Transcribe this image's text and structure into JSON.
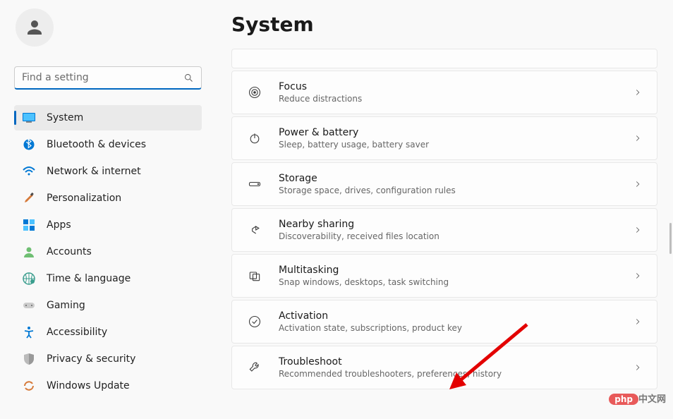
{
  "search": {
    "placeholder": "Find a setting"
  },
  "nav": [
    {
      "label": "System",
      "icon": "display",
      "selected": true
    },
    {
      "label": "Bluetooth & devices",
      "icon": "bluetooth"
    },
    {
      "label": "Network & internet",
      "icon": "wifi"
    },
    {
      "label": "Personalization",
      "icon": "brush"
    },
    {
      "label": "Apps",
      "icon": "apps"
    },
    {
      "label": "Accounts",
      "icon": "user"
    },
    {
      "label": "Time & language",
      "icon": "globe"
    },
    {
      "label": "Gaming",
      "icon": "gamepad"
    },
    {
      "label": "Accessibility",
      "icon": "accessibility"
    },
    {
      "label": "Privacy & security",
      "icon": "shield"
    },
    {
      "label": "Windows Update",
      "icon": "update"
    }
  ],
  "page": {
    "title": "System"
  },
  "cards": [
    {
      "title": "Focus",
      "sub": "Reduce distractions",
      "icon": "focus"
    },
    {
      "title": "Power & battery",
      "sub": "Sleep, battery usage, battery saver",
      "icon": "power"
    },
    {
      "title": "Storage",
      "sub": "Storage space, drives, configuration rules",
      "icon": "storage"
    },
    {
      "title": "Nearby sharing",
      "sub": "Discoverability, received files location",
      "icon": "share"
    },
    {
      "title": "Multitasking",
      "sub": "Snap windows, desktops, task switching",
      "icon": "multitask"
    },
    {
      "title": "Activation",
      "sub": "Activation state, subscriptions, product key",
      "icon": "activation"
    },
    {
      "title": "Troubleshoot",
      "sub": "Recommended troubleshooters, preferences, history",
      "icon": "wrench"
    }
  ],
  "watermark": {
    "pill": "php",
    "text": "中文网"
  }
}
